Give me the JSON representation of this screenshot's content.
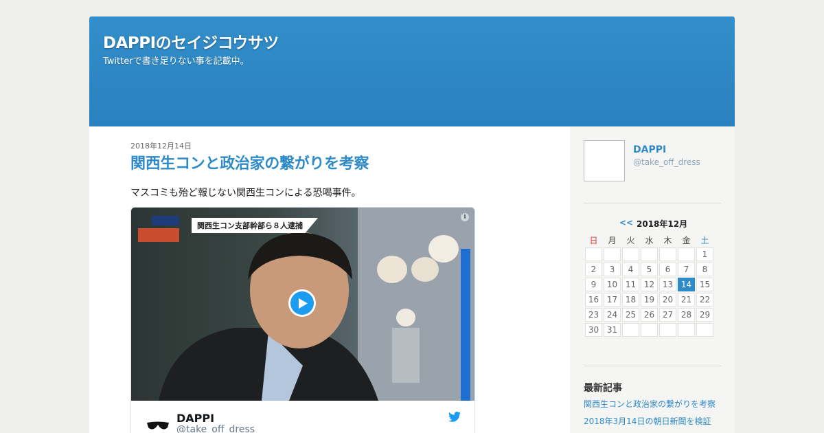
{
  "site": {
    "title": "DAPPIのセイジコウサツ",
    "description": "Twitterで書き足りない事を記載中。"
  },
  "post": {
    "date": "2018年12月14日",
    "title": "関西生コンと政治家の繋がりを考察",
    "body": "マスコミも殆ど報じない関西生コンによる恐喝事件。"
  },
  "tweet_embed": {
    "video_caption": "関西生コン支部幹部ら８人逮捕",
    "author_name": "DAPPI",
    "author_handle": "@take_off_dress",
    "icons": [
      "play-icon",
      "info-icon",
      "twitter-bird-icon",
      "sunglasses-avatar"
    ]
  },
  "sidebar": {
    "profile": {
      "name": "DAPPI",
      "handle": "@take_off_dress"
    },
    "calendar": {
      "prev_label": "<<",
      "month_label": "2018年12月",
      "weekdays": [
        "日",
        "月",
        "火",
        "水",
        "木",
        "金",
        "土"
      ],
      "weeks": [
        [
          "",
          "",
          "",
          "",
          "",
          "",
          "1"
        ],
        [
          "2",
          "3",
          "4",
          "5",
          "6",
          "7",
          "8"
        ],
        [
          "9",
          "10",
          "11",
          "12",
          "13",
          "14",
          "15"
        ],
        [
          "16",
          "17",
          "18",
          "19",
          "20",
          "21",
          "22"
        ],
        [
          "23",
          "24",
          "25",
          "26",
          "27",
          "28",
          "29"
        ],
        [
          "30",
          "31",
          "",
          "",
          "",
          "",
          ""
        ]
      ],
      "today": "14"
    },
    "recent": {
      "heading": "最新記事",
      "items": [
        "関西生コンと政治家の繋がりを考察",
        "2018年3月14日の朝日新聞を検証"
      ]
    }
  },
  "colors": {
    "header_blue": "#2f8ac8",
    "link_blue": "#2f8ac8",
    "today_bg": "#2f8ac8",
    "sunday_red": "#dd3333",
    "twitter_blue": "#1d9bf0"
  }
}
